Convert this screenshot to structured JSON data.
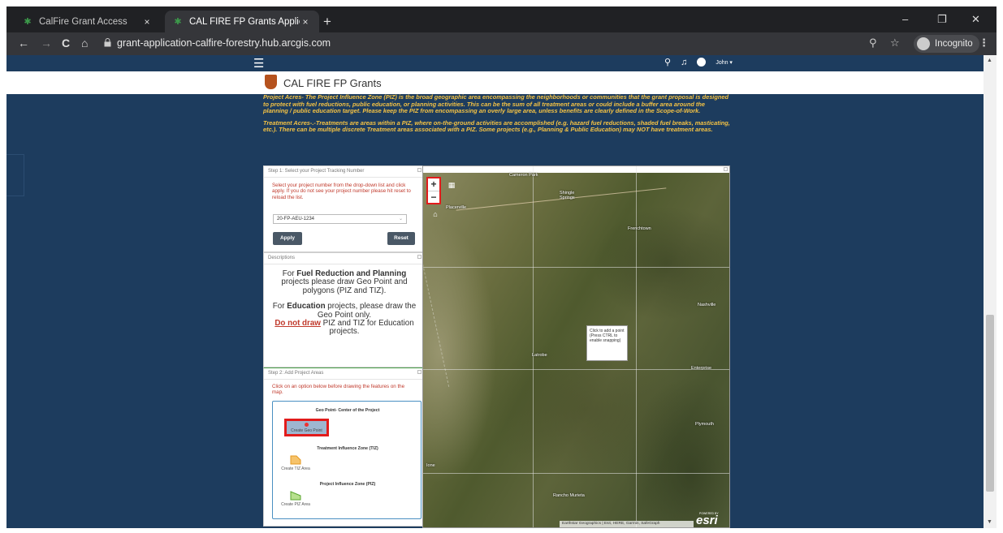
{
  "browser": {
    "tabs": [
      {
        "title": "CalFire Grant Access",
        "close": "×"
      },
      {
        "title": "CAL FIRE FP Grants Application",
        "close": "×"
      }
    ],
    "new_tab": "+",
    "window_controls": {
      "minimize": "–",
      "restore": "❐",
      "close": "✕"
    },
    "nav": {
      "back": "←",
      "forward": "→",
      "reload": "C",
      "home": "⌂"
    },
    "url": "grant-application-calfire-forestry.hub.arcgis.com",
    "incognito_label": "Incognito",
    "menu": "⋮"
  },
  "site": {
    "menu_icon": "☰",
    "user": "John ▾",
    "brand": "CAL FIRE FP Grants",
    "note_project": "Project Acres- The Project Influence Zone (PIZ) is the broad geographic area encompassing the neighborhoods or communities that the grant proposal is designed to protect with fuel reductions, public education, or planning activities. This can be the sum of all treatment areas or could include a buffer area around the planning / public education target. Please keep the PIZ from encompassing an overly large area, unless benefits are clearly defined in the Scope-of-Work.",
    "note_treatment": "Treatment Acres-.-Treatments are areas within a PIZ, where on-the-ground activities are accomplished (e.g. hazard fuel reductions, shaded fuel breaks, masticating, etc.). There can be multiple discrete Treatment areas associated with a PIZ. Some projects (e.g., Planning & Public Education) may NOT have treatment areas."
  },
  "step1": {
    "title": "Step 1: Select your Project Tracking Number",
    "instruction": "Select your project number from the drop-down list and click apply. If you do not see your project number please hit reset to reload the list.",
    "selected_value": "20-FP-AEU-1234",
    "apply_label": "Apply",
    "reset_label": "Reset"
  },
  "descriptions": {
    "title": "Descriptions",
    "para1_pre": "For ",
    "para1_bold": "Fuel Reduction and Planning",
    "para1_post": " projects please draw Geo Point and polygons (PIZ and TIZ).",
    "para2_pre": "For ",
    "para2_bold": "Education",
    "para2_post": " projects, please draw the Geo Point only.",
    "dnd": "Do not draw",
    "para3_post": " PIZ and TIZ for Education projects."
  },
  "step2": {
    "title": "Step 2: Add Project Areas",
    "instruction": "Click on an option below before drawing the features on the map.",
    "geo_header": "Geo Point- Center of the Project",
    "geo_button": "Create Geo Point",
    "tiz_header": "Treatment Influence Zone (TIZ)",
    "tiz_button": "Create TIZ Area",
    "piz_header": "Project Influence Zone (PIZ)",
    "piz_button": "Create PIZ Area"
  },
  "map": {
    "zoom_in": "+",
    "zoom_out": "−",
    "places": [
      "Cameron Park",
      "Placerville",
      "Shingle Springs",
      "Frenchtown",
      "Nashville",
      "Latrobe",
      "Enterprise",
      "Plymouth",
      "Ione",
      "Rancho Murieta"
    ],
    "tooltip": "Click to add a point (Press CTRL to enable snapping)",
    "attribution": "Earthstar Geographics | Esri, HERE, Garmin, SafeGraph",
    "esri": "esri",
    "esri_sub": "POWERED BY"
  },
  "colors": {
    "page_bg": "#1d3c5e",
    "note_text": "#f4c244",
    "warn_text": "#c0392b",
    "highlight": "#e21b1b"
  }
}
